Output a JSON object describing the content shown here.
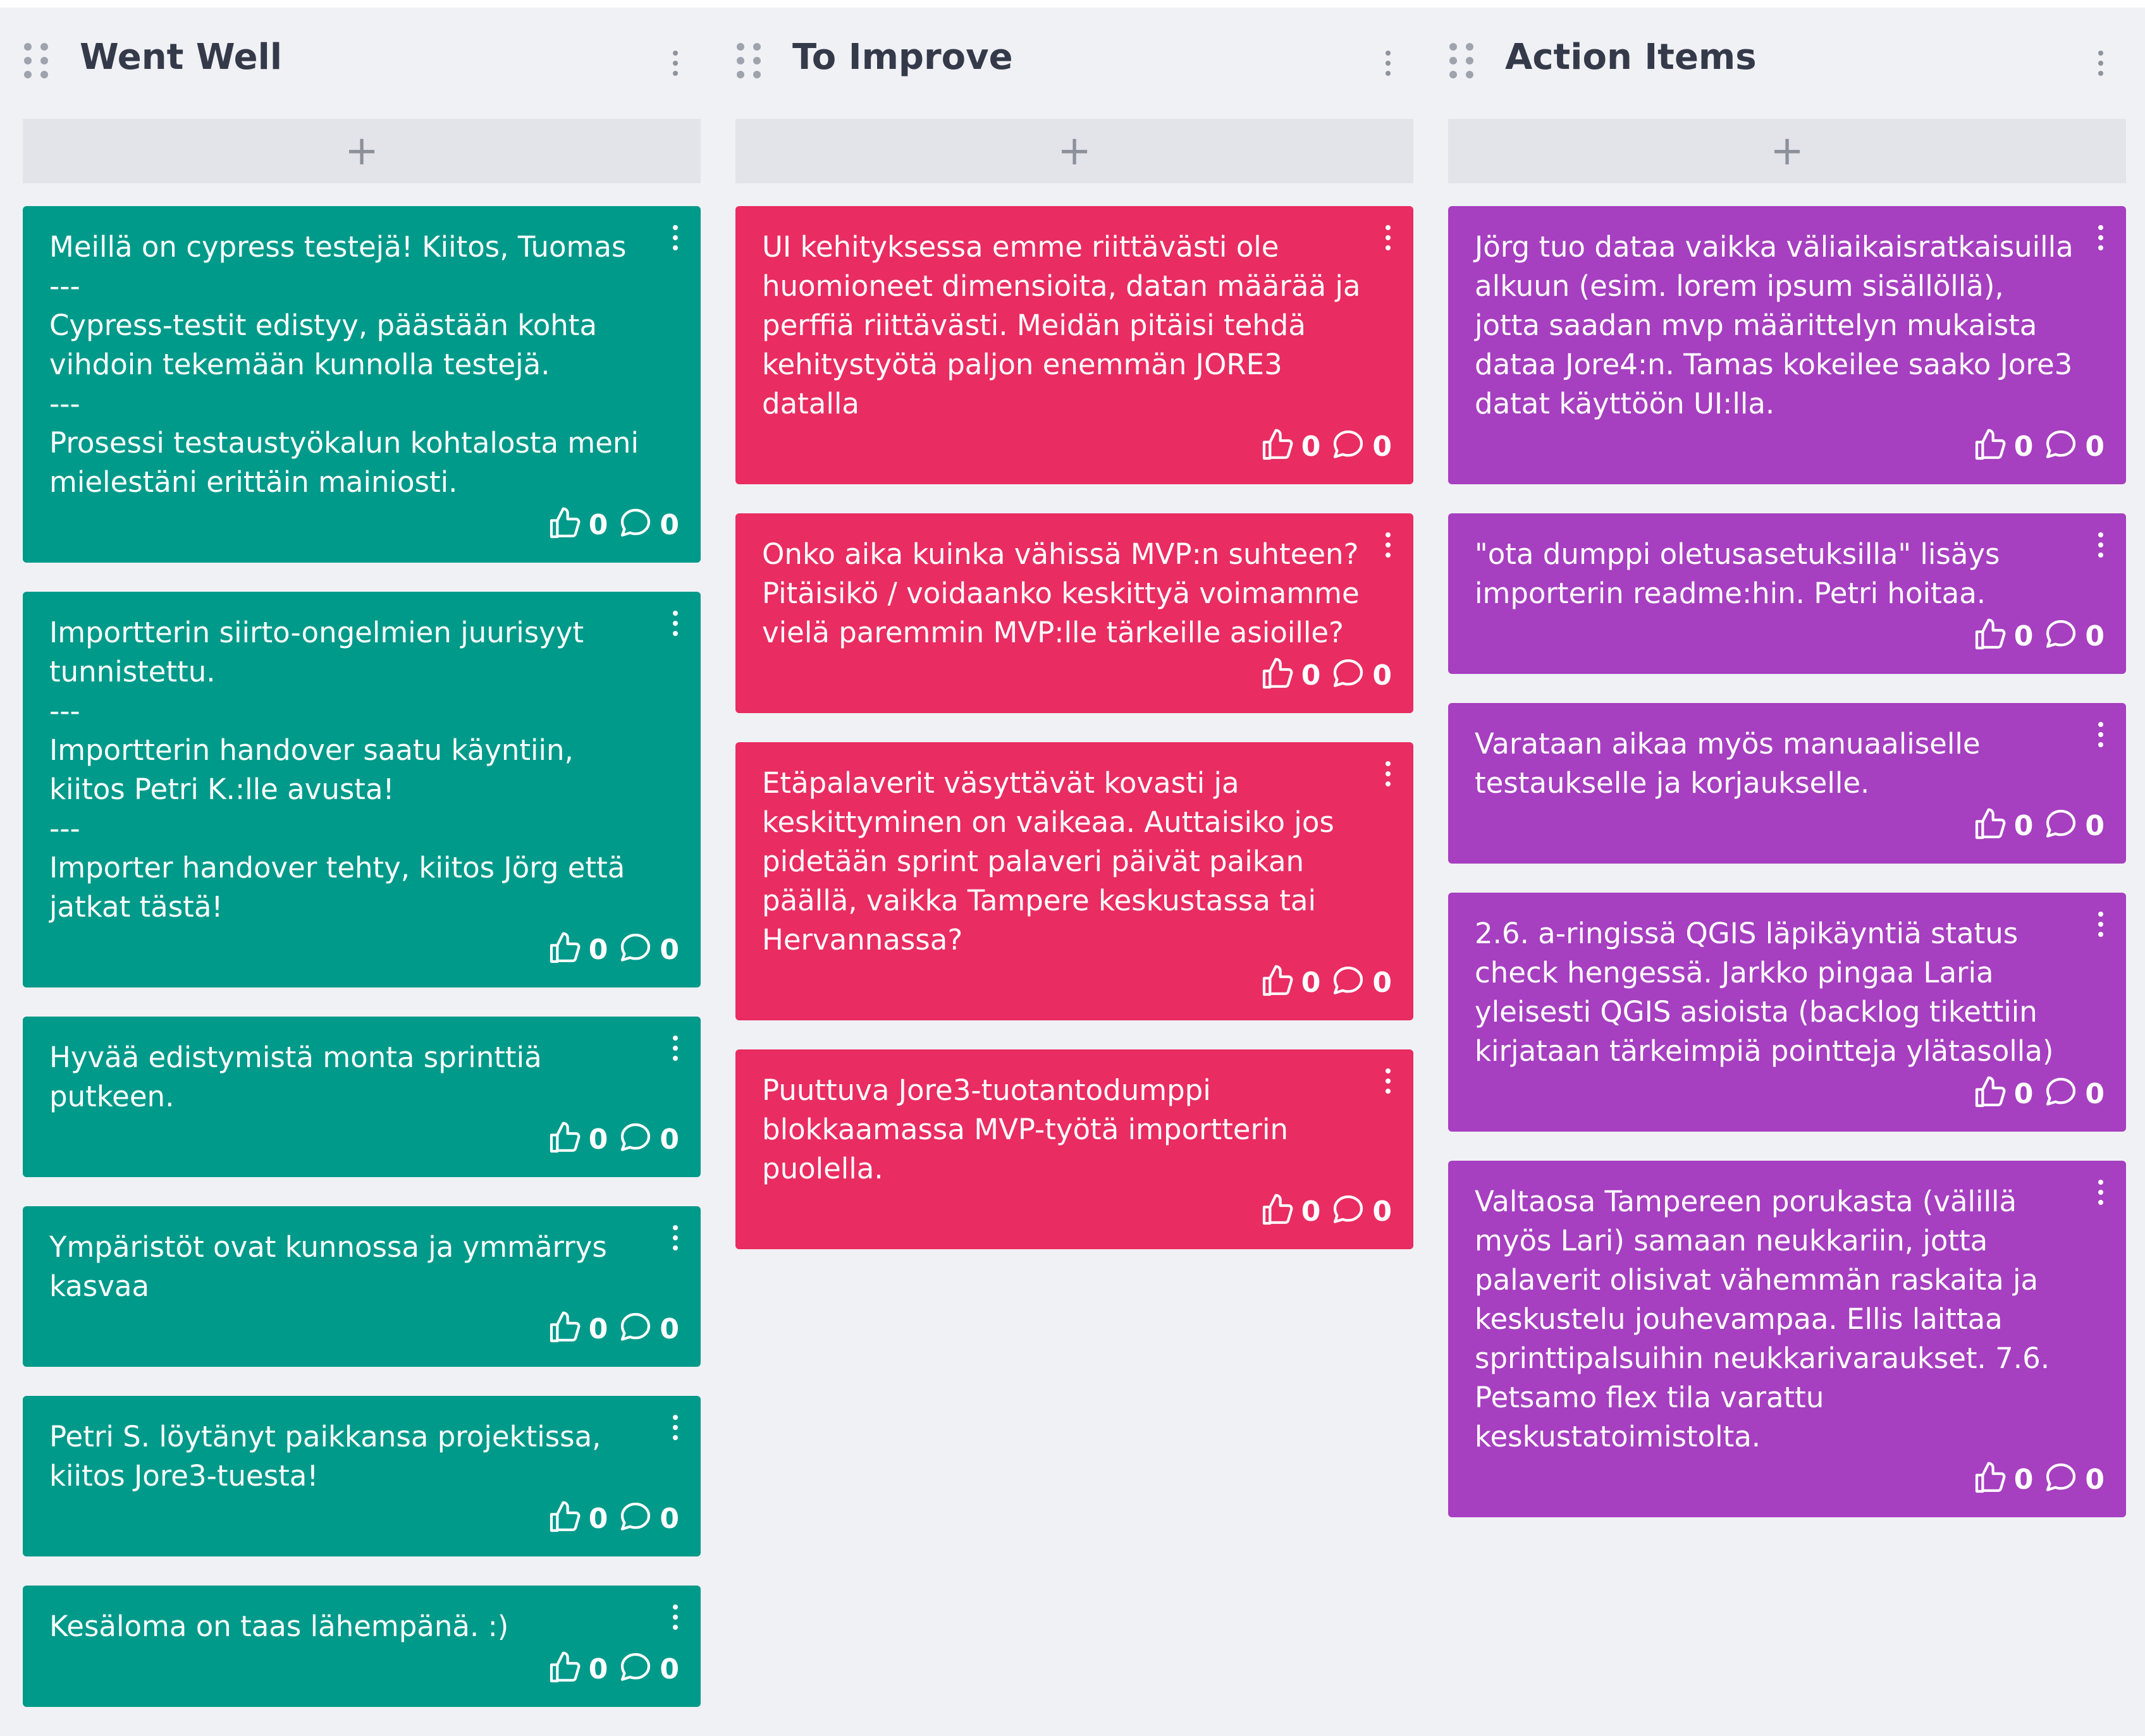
{
  "colors": {
    "went_well": "#009a8a",
    "to_improve": "#e92c61",
    "action_items": "#a63fc0",
    "background": "#f0f1f5",
    "add_button": "#e3e4e9"
  },
  "add_icon": "+",
  "icons": {
    "like": "thumbs-up-icon",
    "comment": "comment-bubble-icon",
    "menu": "kebab-menu-icon",
    "drag": "drag-handle-icon"
  },
  "columns": [
    {
      "title": "Went Well",
      "cards": [
        {
          "text": "Meillä on cypress testejä! Kiitos, Tuomas\n---\nCypress-testit edistyy, päästään kohta vihdoin tekemään kunnolla testejä.\n---\nProsessi testaustyökalun kohtalosta meni mielestäni erittäin mainiosti.",
          "likes": "0",
          "comments": "0"
        },
        {
          "text": "Importterin siirto-ongelmien juurisyyt tunnistettu.\n---\nImportterin handover saatu käyntiin, kiitos Petri K.:lle avusta!\n---\nImporter handover tehty, kiitos Jörg että jatkat tästä!",
          "likes": "0",
          "comments": "0"
        },
        {
          "text": "Hyvää edistymistä monta sprinttiä putkeen.",
          "likes": "0",
          "comments": "0"
        },
        {
          "text": "Ympäristöt ovat kunnossa ja ymmärrys kasvaa",
          "likes": "0",
          "comments": "0"
        },
        {
          "text": "Petri S. löytänyt paikkansa projektissa, kiitos Jore3-tuesta!",
          "likes": "0",
          "comments": "0"
        },
        {
          "text": "Kesäloma on taas lähempänä. :)",
          "likes": "0",
          "comments": "0"
        }
      ]
    },
    {
      "title": "To Improve",
      "cards": [
        {
          "text": "UI kehityksessa emme riittävästi ole huomioneet dimensioita, datan määrää ja perffiä riittävästi. Meidän pitäisi tehdä kehitystyötä paljon enemmän JORE3 datalla",
          "likes": "0",
          "comments": "0"
        },
        {
          "text": "Onko aika kuinka vähissä MVP:n suhteen? Pitäisikö / voidaanko keskittyä voimamme vielä paremmin MVP:lle tärkeille asioille?",
          "likes": "0",
          "comments": "0"
        },
        {
          "text": "Etäpalaverit väsyttävät kovasti ja keskittyminen on vaikeaa. Auttaisiko jos pidetään sprint palaveri päivät paikan päällä, vaikka Tampere keskustassa tai Hervannassa?",
          "likes": "0",
          "comments": "0"
        },
        {
          "text": "Puuttuva Jore3-tuotantodumppi blokkaamassa MVP-työtä importterin puolella.",
          "likes": "0",
          "comments": "0"
        }
      ]
    },
    {
      "title": "Action Items",
      "cards": [
        {
          "text": "Jörg tuo dataa vaikka väliaikaisratkaisuilla alkuun (esim. lorem ipsum sisällöllä), jotta saadan mvp määrittelyn mukaista dataa Jore4:n. Tamas kokeilee saako Jore3 datat käyttöön UI:lla.",
          "likes": "0",
          "comments": "0"
        },
        {
          "text": "\"ota dumppi oletusasetuksilla\" lisäys importerin readme:hin. Petri hoitaa.",
          "likes": "0",
          "comments": "0"
        },
        {
          "text": "Varataan aikaa myös manuaaliselle testaukselle ja korjaukselle.",
          "likes": "0",
          "comments": "0"
        },
        {
          "text": "2.6. a-ringissä QGIS läpikäyntiä status check hengessä. Jarkko pingaa Laria yleisesti QGIS asioista (backlog tikettiin kirjataan tärkeimpiä pointteja ylätasolla)",
          "likes": "0",
          "comments": "0"
        },
        {
          "text": "Valtaosa Tampereen porukasta (välillä myös Lari) samaan neukkariin, jotta palaverit olisivat vähemmän raskaita ja keskustelu jouhevampaa. Ellis laittaa sprinttipalsuihin neukkarivaraukset. 7.6. Petsamo flex tila varattu keskustatoimistolta.",
          "likes": "0",
          "comments": "0"
        }
      ]
    }
  ]
}
